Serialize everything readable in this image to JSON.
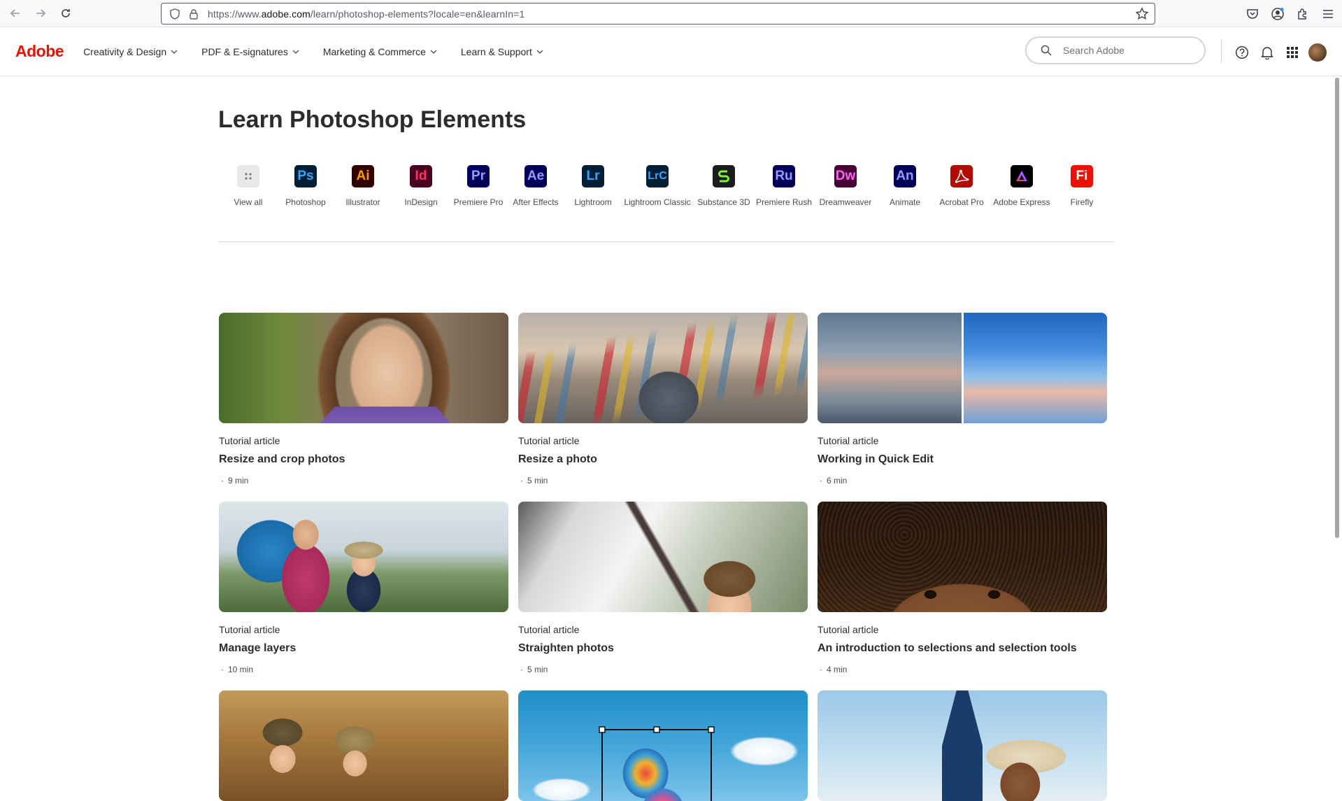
{
  "browser": {
    "url_prefix": "https://www.",
    "url_domain": "adobe.com",
    "url_path": "/learn/photoshop-elements?locale=en&learnIn=1"
  },
  "header": {
    "logo": "Adobe",
    "nav": [
      {
        "label": "Creativity & Design"
      },
      {
        "label": "PDF & E-signatures"
      },
      {
        "label": "Marketing & Commerce"
      },
      {
        "label": "Learn & Support"
      }
    ],
    "search_placeholder": "Search Adobe"
  },
  "page": {
    "title": "Learn Photoshop Elements"
  },
  "apps": [
    {
      "label": "View all",
      "abbr": "",
      "bg": "#e8e8e8",
      "fg": "#6e6e6e",
      "icon": "grid-icon"
    },
    {
      "label": "Photoshop",
      "abbr": "Ps",
      "bg": "#001e36",
      "fg": "#31a8ff"
    },
    {
      "label": "Illustrator",
      "abbr": "Ai",
      "bg": "#330000",
      "fg": "#ff9a00"
    },
    {
      "label": "InDesign",
      "abbr": "Id",
      "bg": "#49021f",
      "fg": "#ff3366"
    },
    {
      "label": "Premiere Pro",
      "abbr": "Pr",
      "bg": "#00005b",
      "fg": "#9999ff"
    },
    {
      "label": "After Effects",
      "abbr": "Ae",
      "bg": "#00005b",
      "fg": "#9999ff"
    },
    {
      "label": "Lightroom",
      "abbr": "Lr",
      "bg": "#001e36",
      "fg": "#31a8ff"
    },
    {
      "label": "Lightroom Classic",
      "abbr": "LrC",
      "bg": "#001e36",
      "fg": "#31a8ff"
    },
    {
      "label": "Substance 3D",
      "abbr": "",
      "bg": "#1c1c1c",
      "fg": "#7df33c",
      "icon": "substance-icon"
    },
    {
      "label": "Premiere Rush",
      "abbr": "Ru",
      "bg": "#00005b",
      "fg": "#9999ff"
    },
    {
      "label": "Dreamweaver",
      "abbr": "Dw",
      "bg": "#470137",
      "fg": "#ff61f6"
    },
    {
      "label": "Animate",
      "abbr": "An",
      "bg": "#00005b",
      "fg": "#9999ff"
    },
    {
      "label": "Acrobat Pro",
      "abbr": "",
      "bg": "#b30b00",
      "fg": "#ffffff",
      "icon": "acrobat-icon"
    },
    {
      "label": "Adobe Express",
      "abbr": "",
      "bg": "#000000",
      "fg": "#ffffff",
      "icon": "express-icon"
    },
    {
      "label": "Firefly",
      "abbr": "Fi",
      "bg": "#eb1000",
      "fg": "#ffffff"
    }
  ],
  "cards": [
    {
      "kind": "Tutorial article",
      "title": "Resize and crop photos",
      "duration": "9 min",
      "image": "girl-fence"
    },
    {
      "kind": "Tutorial article",
      "title": "Resize a photo",
      "duration": "5 min",
      "image": "love-locks"
    },
    {
      "kind": "Tutorial article",
      "title": "Working in Quick Edit",
      "duration": "6 min",
      "image": "sky-split"
    },
    {
      "kind": "Tutorial article",
      "title": "Manage layers",
      "duration": "10 min",
      "image": "hikers"
    },
    {
      "kind": "Tutorial article",
      "title": "Straighten photos",
      "duration": "5 min",
      "image": "boy-window"
    },
    {
      "kind": "Tutorial article",
      "title": "An introduction to selections and selection tools",
      "duration": "4 min",
      "image": "curly-hair"
    },
    {
      "kind": "",
      "title": "",
      "duration": "",
      "image": "kids-tent"
    },
    {
      "kind": "",
      "title": "",
      "duration": "",
      "image": "balloons"
    },
    {
      "kind": "",
      "title": "",
      "duration": "",
      "image": "eiffel"
    }
  ]
}
